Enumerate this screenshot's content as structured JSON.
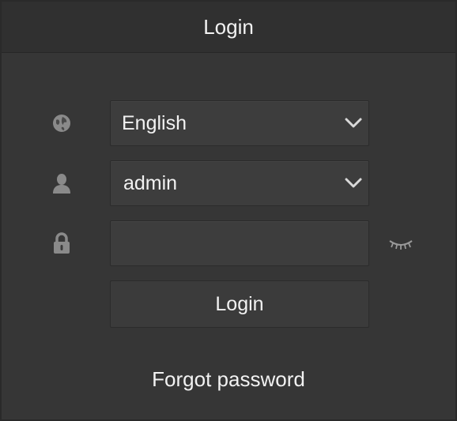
{
  "dialog": {
    "title": "Login"
  },
  "language": {
    "icon": "globe-icon",
    "selected": "English"
  },
  "user": {
    "icon": "user-icon",
    "selected": "admin"
  },
  "password": {
    "icon": "lock-icon",
    "value": "",
    "toggle_icon": "eye-closed-icon"
  },
  "actions": {
    "login_label": "Login",
    "forgot_label": "Forgot password"
  }
}
